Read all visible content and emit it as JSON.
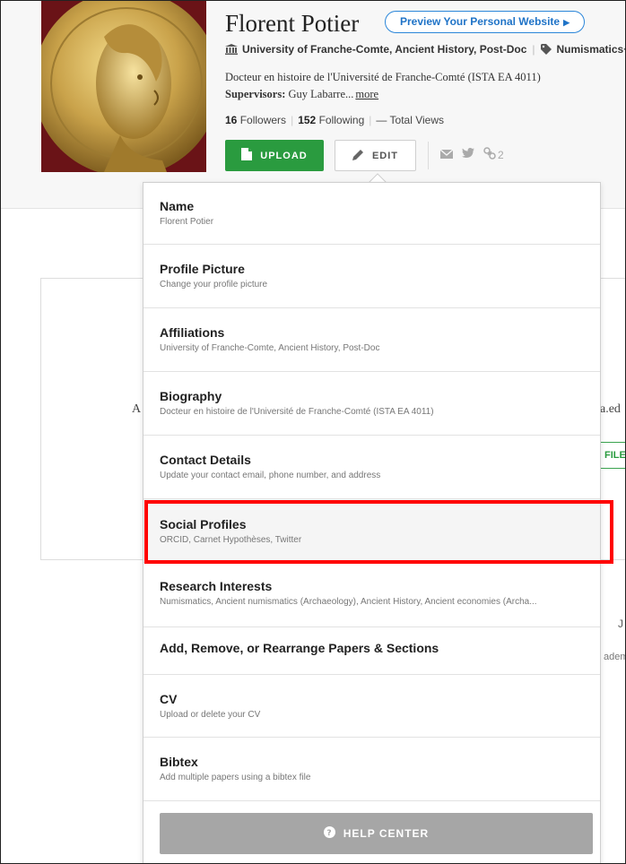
{
  "profile": {
    "name": "Florent Potier",
    "preview_label": "Preview Your Personal Website",
    "affiliation": "University of Franche-Comte, Ancient History, Post-Doc",
    "tag": "Numismatics",
    "tag_more": "+",
    "bio": "Docteur en histoire de l'Université de Franche-Comté (ISTA EA 4011)",
    "supervisors_label": "Supervisors:",
    "supervisors_value": "Guy Labarre...",
    "more_link": "more",
    "followers_count": "16",
    "followers_label": "Followers",
    "following_count": "152",
    "following_label": "Following",
    "views_value": "—",
    "views_label": "Total Views",
    "upload_label": "UPLOAD",
    "edit_label": "EDIT",
    "links_count": "2"
  },
  "background": {
    "letter_a": "A",
    "edu_text": "a.ed",
    "file_btn": "FILE",
    "j_text": "J",
    "adem_text": "adem"
  },
  "menu": {
    "items": [
      {
        "title": "Name",
        "sub": "Florent Potier"
      },
      {
        "title": "Profile Picture",
        "sub": "Change your profile picture"
      },
      {
        "title": "Affiliations",
        "sub": "University of Franche-Comte, Ancient History, Post-Doc"
      },
      {
        "title": "Biography",
        "sub": "Docteur en histoire de l'Université de Franche-Comté (ISTA EA 4011)"
      },
      {
        "title": "Contact Details",
        "sub": "Update your contact email, phone number, and address"
      },
      {
        "title": "Social Profiles",
        "sub": "ORCID, Carnet Hypothèses, Twitter"
      },
      {
        "title": "Research Interests",
        "sub": "Numismatics, Ancient numismatics (Archaeology), Ancient History, Ancient economies (Archa..."
      },
      {
        "title": "Add, Remove, or Rearrange Papers & Sections",
        "sub": ""
      },
      {
        "title": "CV",
        "sub": "Upload or delete your CV"
      },
      {
        "title": "Bibtex",
        "sub": "Add multiple papers using a bibtex file"
      }
    ],
    "help_label": "HELP CENTER"
  },
  "colors": {
    "upload_green": "#2a9b3f",
    "link_blue": "#1f73c7",
    "highlight_red": "#ff0000"
  }
}
